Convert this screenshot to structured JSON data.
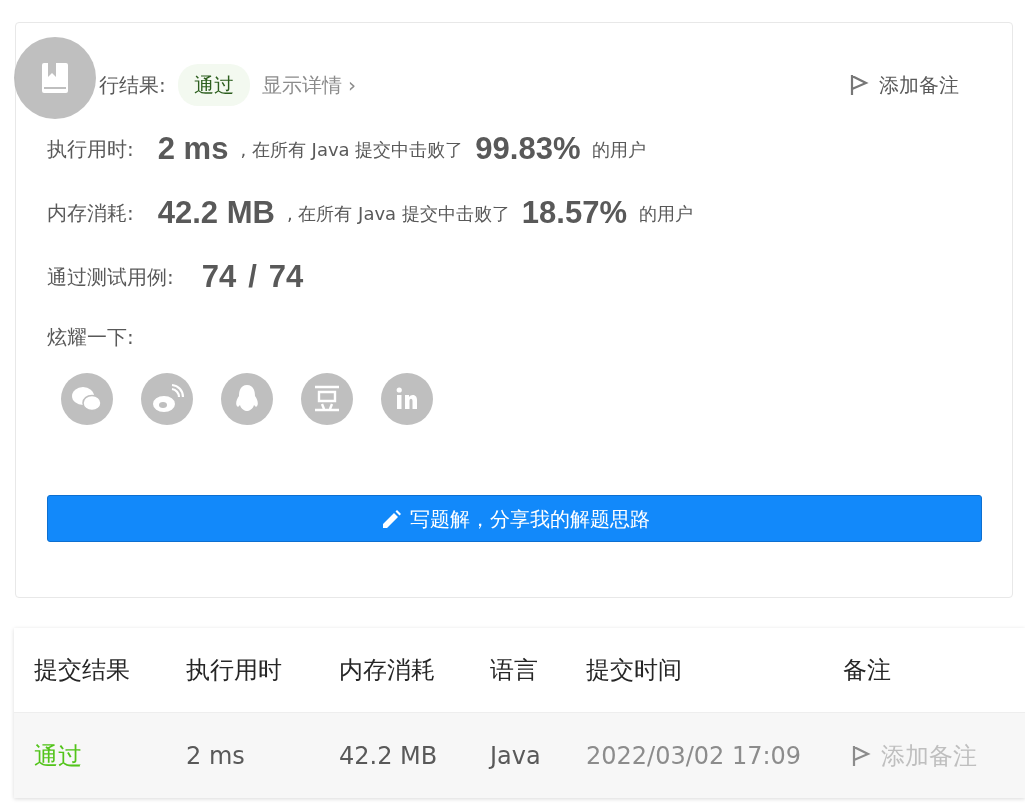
{
  "result": {
    "label": "行结果:",
    "status": "通过",
    "details_link": "显示详情",
    "details_caret": "›",
    "note_button": "添加备注"
  },
  "stats": [
    {
      "label": "执行用时:",
      "value": "2 ms",
      "text": ", 在所有 Java 提交中击败了",
      "percent": "99.83%",
      "suffix": "的用户"
    },
    {
      "label": "内存消耗:",
      "value": "42.2 MB",
      "text": ", 在所有 Java 提交中击败了",
      "percent": "18.57%",
      "suffix": "的用户"
    }
  ],
  "tests": {
    "label": "通过测试用例:",
    "passed": "74",
    "separator": "/",
    "total": "74"
  },
  "share": {
    "label": "炫耀一下:",
    "icons": [
      {
        "kind": "wechat"
      },
      {
        "kind": "weibo"
      },
      {
        "kind": "qq"
      },
      {
        "kind": "douban"
      },
      {
        "kind": "linkedin"
      }
    ]
  },
  "write_button": "写题解，分享我的解题思路",
  "table": {
    "columns": [
      "提交结果",
      "执行用时",
      "内存消耗",
      "语言",
      "提交时间",
      "备注"
    ],
    "rows": [
      {
        "status": "通过",
        "time": "2 ms",
        "memory": "42.2 MB",
        "language": "Java",
        "submitted": "2022/03/02 17:09",
        "note": "添加备注"
      }
    ]
  }
}
